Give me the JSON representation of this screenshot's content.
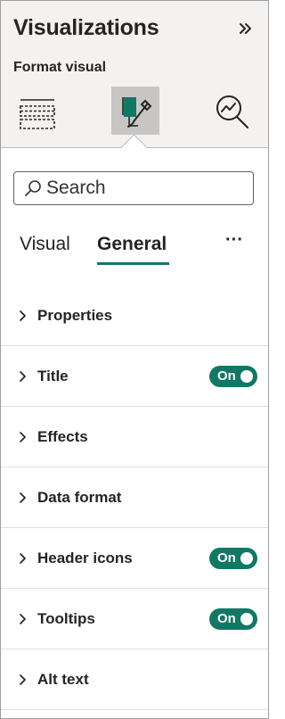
{
  "pane": {
    "title": "Visualizations",
    "collapse_icon": "double-chevron-right-icon"
  },
  "format": {
    "label": "Format visual",
    "icons": [
      "build-visual-icon",
      "format-visual-icon",
      "analytics-icon"
    ],
    "selected": "format-visual-icon"
  },
  "search": {
    "placeholder": "Search",
    "value": ""
  },
  "tabs": [
    {
      "label": "Visual",
      "active": false
    },
    {
      "label": "General",
      "active": true
    }
  ],
  "more_label": "···",
  "sections": [
    {
      "label": "Properties",
      "toggle": null
    },
    {
      "label": "Title",
      "toggle": "On"
    },
    {
      "label": "Effects",
      "toggle": null
    },
    {
      "label": "Data format",
      "toggle": null
    },
    {
      "label": "Header icons",
      "toggle": "On"
    },
    {
      "label": "Tooltips",
      "toggle": "On"
    },
    {
      "label": "Alt text",
      "toggle": null
    }
  ],
  "colors": {
    "accent": "#117865",
    "pane_background": "#f3f2f1",
    "selected_icon_background": "#c8c6c4"
  }
}
